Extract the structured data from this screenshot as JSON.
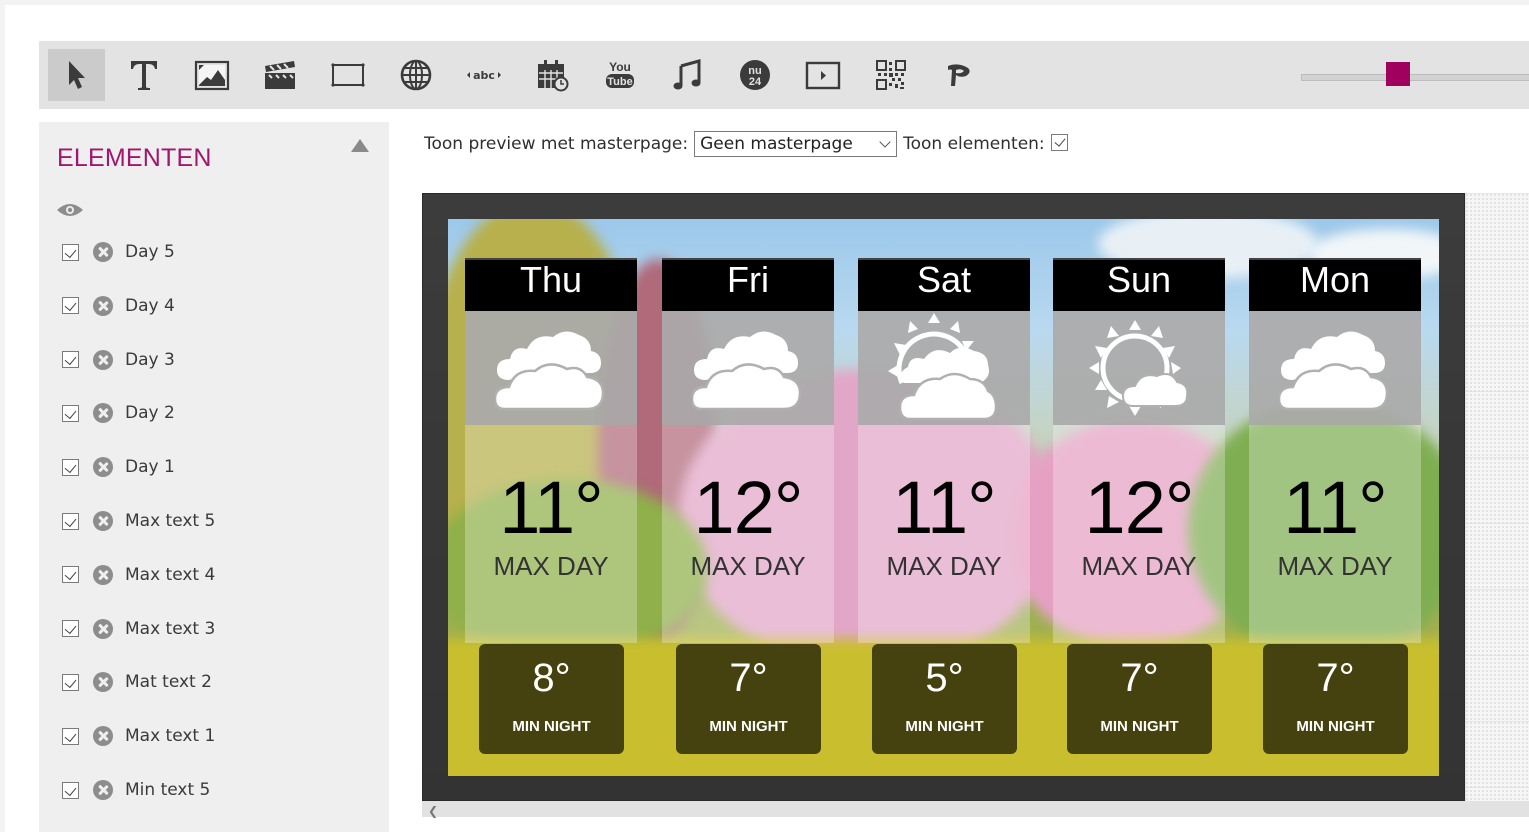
{
  "toolbar": {
    "tools": [
      {
        "name": "select-tool",
        "icon": "cursor-arrow-icon",
        "active": true
      },
      {
        "name": "text-tool",
        "icon": "text-T-icon"
      },
      {
        "name": "image-tool",
        "icon": "image-icon"
      },
      {
        "name": "video-tool",
        "icon": "clapperboard-icon"
      },
      {
        "name": "rectangle-tool",
        "icon": "rectangle-icon"
      },
      {
        "name": "web-tool",
        "icon": "globe-icon"
      },
      {
        "name": "ticker-tool",
        "icon": "ticker-abc-icon",
        "label": "abc"
      },
      {
        "name": "calendar-tool",
        "icon": "calendar-clock-icon"
      },
      {
        "name": "youtube-tool",
        "icon": "youtube-icon",
        "label_top": "You",
        "label_bottom": "Tube"
      },
      {
        "name": "music-tool",
        "icon": "music-note-icon"
      },
      {
        "name": "nu24-tool",
        "icon": "nu24-icon",
        "label_top": "nu",
        "label_bottom": "24"
      },
      {
        "name": "media-player-tool",
        "icon": "play-box-icon"
      },
      {
        "name": "qr-tool",
        "icon": "qr-code-icon"
      },
      {
        "name": "custom-tool",
        "icon": "p-logo-icon"
      }
    ],
    "zoom_slider": {
      "value_fraction": 0.4,
      "accent": "#a0005e"
    }
  },
  "sidebar": {
    "title": "ELEMENTEN",
    "visibility_icon": "eye-icon",
    "items": [
      {
        "label": "Day 5",
        "checked": true
      },
      {
        "label": "Day 4",
        "checked": true
      },
      {
        "label": "Day 3",
        "checked": true
      },
      {
        "label": "Day 2",
        "checked": true
      },
      {
        "label": "Day 1",
        "checked": true
      },
      {
        "label": "Max text 5",
        "checked": true
      },
      {
        "label": "Max text 4",
        "checked": true
      },
      {
        "label": "Max text 3",
        "checked": true
      },
      {
        "label": "Mat text 2",
        "checked": true
      },
      {
        "label": "Max text 1",
        "checked": true
      },
      {
        "label": "Min text 5",
        "checked": true
      }
    ]
  },
  "options": {
    "masterpage_label": "Toon preview met masterpage:",
    "masterpage_value": "Geen masterpage",
    "show_elements_label": "Toon elementen:",
    "show_elements_checked": true
  },
  "preview": {
    "days": [
      {
        "day": "Thu",
        "icon": "cloudy-icon",
        "max": "11°",
        "max_label": "MAX DAY",
        "min": "8°",
        "min_label": "MIN NIGHT"
      },
      {
        "day": "Fri",
        "icon": "cloudy-icon",
        "max": "12°",
        "max_label": "MAX DAY",
        "min": "7°",
        "min_label": "MIN NIGHT"
      },
      {
        "day": "Sat",
        "icon": "partly-cloudy-icon",
        "max": "11°",
        "max_label": "MAX DAY",
        "min": "5°",
        "min_label": "MIN NIGHT"
      },
      {
        "day": "Sun",
        "icon": "mostly-sunny-icon",
        "max": "12°",
        "max_label": "MAX DAY",
        "min": "7°",
        "min_label": "MIN NIGHT"
      },
      {
        "day": "Mon",
        "icon": "cloudy-icon",
        "max": "11°",
        "max_label": "MAX DAY",
        "min": "7°",
        "min_label": "MIN NIGHT"
      }
    ]
  }
}
